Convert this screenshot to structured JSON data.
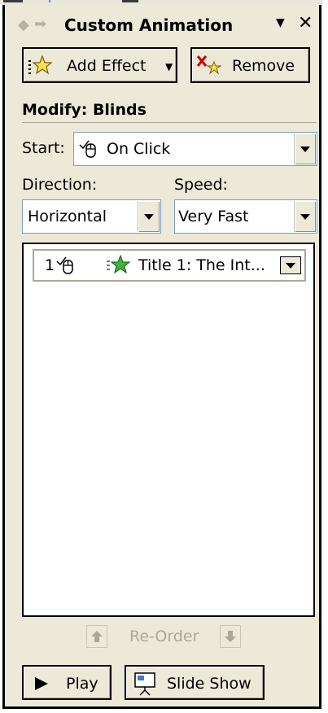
{
  "header": {
    "title": "Custom Animation",
    "back_icon": "back-arrow-icon",
    "forward_icon": "forward-arrow-icon",
    "menu_icon": "chevron-down-icon",
    "close_icon": "close-icon"
  },
  "toolbar": {
    "add_effect_label": "Add Effect",
    "remove_label": "Remove"
  },
  "modify": {
    "heading": "Modify: Blinds",
    "start_label": "Start:",
    "start_value": "On Click",
    "direction_label": "Direction:",
    "direction_value": "Horizontal",
    "speed_label": "Speed:",
    "speed_value": "Very Fast"
  },
  "effects_list": {
    "items": [
      {
        "order": "1",
        "name": "Title 1: The Int..."
      }
    ]
  },
  "reorder": {
    "label": "Re-Order"
  },
  "footer": {
    "play_label": "Play",
    "slideshow_label": "Slide Show"
  },
  "colors": {
    "pane_background": "#ece9d8",
    "separator": "#aca899",
    "list_border": "#000000",
    "disabled_text": "#aca899"
  }
}
